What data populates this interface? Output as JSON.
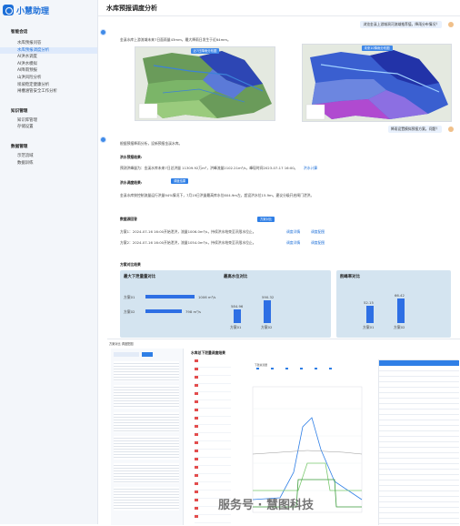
{
  "app": {
    "name": "小慧助理"
  },
  "sidebar": {
    "sections": [
      {
        "title": "智能会话",
        "items": [
          {
            "label": "水库预报问答",
            "active": false
          },
          {
            "label": "水库预报调度分析",
            "active": true
          },
          {
            "label": "AI洪水调度",
            "active": false
          },
          {
            "label": "AI洪水模拟",
            "active": false
          },
          {
            "label": "AI降雨预报",
            "active": false
          },
          {
            "label": "山洪风险分析",
            "active": false
          },
          {
            "label": "坝坡稳定健康分析",
            "active": false
          },
          {
            "label": "闸槽涵管安全工作分析",
            "active": false
          }
        ]
      },
      {
        "title": "知识管理",
        "items": [
          {
            "label": "知识库管理"
          },
          {
            "label": "存储设置"
          }
        ]
      },
      {
        "title": "数据管理",
        "items": [
          {
            "label": "示范流域"
          },
          {
            "label": "数据训练"
          }
        ]
      }
    ]
  },
  "page": {
    "title": "水库预报调度分析"
  },
  "chat": {
    "user_q1": "浏览金溪上游城洞河流域推荐值，降雨分布情况？",
    "bot_a1": "金溪水库上游流域未来7日面雨量43mm，最大降雨日发生于近64mm。",
    "map_left_btn": "近7日降雨分布图",
    "map_right_btn": "未来10降雨分布图",
    "user_q2": "降雨设置模拟预报方案。问题？",
    "bot_intro": "根据预报降雨分析，设新预报金溪水库。",
    "sec1_title": "洪水预报结果:",
    "sec1_line": "预测洪峰量为：金溪水库未来7日总洪量 11309.92万m³，洪峰流量2102.21m³/s，峰现时间2023-07-17 16:00。",
    "sec1_link": "洪水计算",
    "sec2_title": "洪水调度结果:",
    "sec2_btn": "调度结果",
    "sec2_line": "金溪水库按控制流量运行洪量94%情况下，7月19日洪量最高库水位604.9m左，超设洪水位15.9m，建议分级开启闸门泄洪。",
    "sec3_title": "数据源回答",
    "sec3_btn": "方案对比",
    "plans": [
      {
        "text": "方案1：2024-07-16 16:00开始泄洪，流量1006.0m³/s，持续洪水结束至汛限水位止。",
        "links": [
          "调度详情",
          "调度配图"
        ]
      },
      {
        "text": "方案2：2024-07-16 16:00开始泄洪，流量1054.0m³/s，持续洪水结束至汛限水位止。",
        "links": [
          "调度详情",
          "调度配图"
        ]
      }
    ],
    "compare_title": "方案对比结果"
  },
  "cards": [
    {
      "title": "最大下泄量量对比",
      "bars": [
        {
          "label": "方案01",
          "value": "1006 m³/s"
        },
        {
          "label": "方案02",
          "value": "798 m³/s"
        }
      ]
    },
    {
      "title": "最高水位对比",
      "bars": [
        {
          "label": "方案01",
          "value": "584.96"
        },
        {
          "label": "方案02",
          "value": "590.32"
        }
      ]
    },
    {
      "title": "削峰率对比",
      "bars": [
        {
          "label": "方案01",
          "value": "52.15"
        },
        {
          "label": "方案02",
          "value": "66.42"
        }
      ]
    }
  ],
  "bottom": {
    "left_header": "方案对比 调度配图",
    "panel_title": "水库总下泄量调度结果",
    "legend": [
      "下泄总流量",
      "入库流量",
      "水位",
      "泄洪",
      "闸门1",
      "闸门2",
      "闸门3",
      "闸门4"
    ],
    "watermark": "服务号 · 慧图科技"
  },
  "colors": {
    "accent": "#2f7fe6",
    "bar": "#2e6fe4",
    "card": "#d4e4f0"
  }
}
